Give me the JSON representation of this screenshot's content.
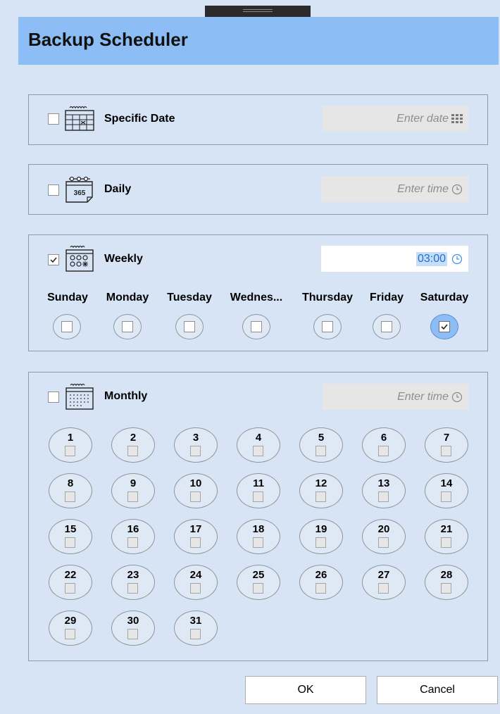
{
  "window": {
    "title": "Backup Scheduler"
  },
  "specific_date": {
    "label": "Specific Date",
    "checked": false,
    "field_placeholder": "Enter date",
    "field_icon": "calendar-grid-icon",
    "section_icon": "calendar-day-icon"
  },
  "daily": {
    "label": "Daily",
    "checked": false,
    "field_placeholder": "Enter time",
    "field_icon": "clock-icon",
    "section_icon": "calendar-365-icon"
  },
  "weekly": {
    "label": "Weekly",
    "checked": true,
    "time_value": "03:00",
    "field_icon": "clock-icon",
    "section_icon": "calendar-week-icon",
    "days": [
      {
        "label": "Sunday",
        "checked": false
      },
      {
        "label": "Monday",
        "checked": false
      },
      {
        "label": "Tuesday",
        "checked": false
      },
      {
        "label": "Wednes...",
        "checked": false
      },
      {
        "label": "Thursday",
        "checked": false
      },
      {
        "label": "Friday",
        "checked": false
      },
      {
        "label": "Saturday",
        "checked": true
      }
    ]
  },
  "monthly": {
    "label": "Monthly",
    "checked": false,
    "field_placeholder": "Enter time",
    "field_icon": "clock-icon",
    "section_icon": "calendar-month-icon",
    "days": [
      "1",
      "2",
      "3",
      "4",
      "5",
      "6",
      "7",
      "8",
      "9",
      "10",
      "11",
      "12",
      "13",
      "14",
      "15",
      "16",
      "17",
      "18",
      "19",
      "20",
      "21",
      "22",
      "23",
      "24",
      "25",
      "26",
      "27",
      "28",
      "29",
      "30",
      "31"
    ]
  },
  "buttons": {
    "ok": "OK",
    "cancel": "Cancel"
  },
  "colors": {
    "accent": "#8cbef5",
    "background": "#d6e4f5",
    "disabled_field": "#e6e6e6"
  }
}
